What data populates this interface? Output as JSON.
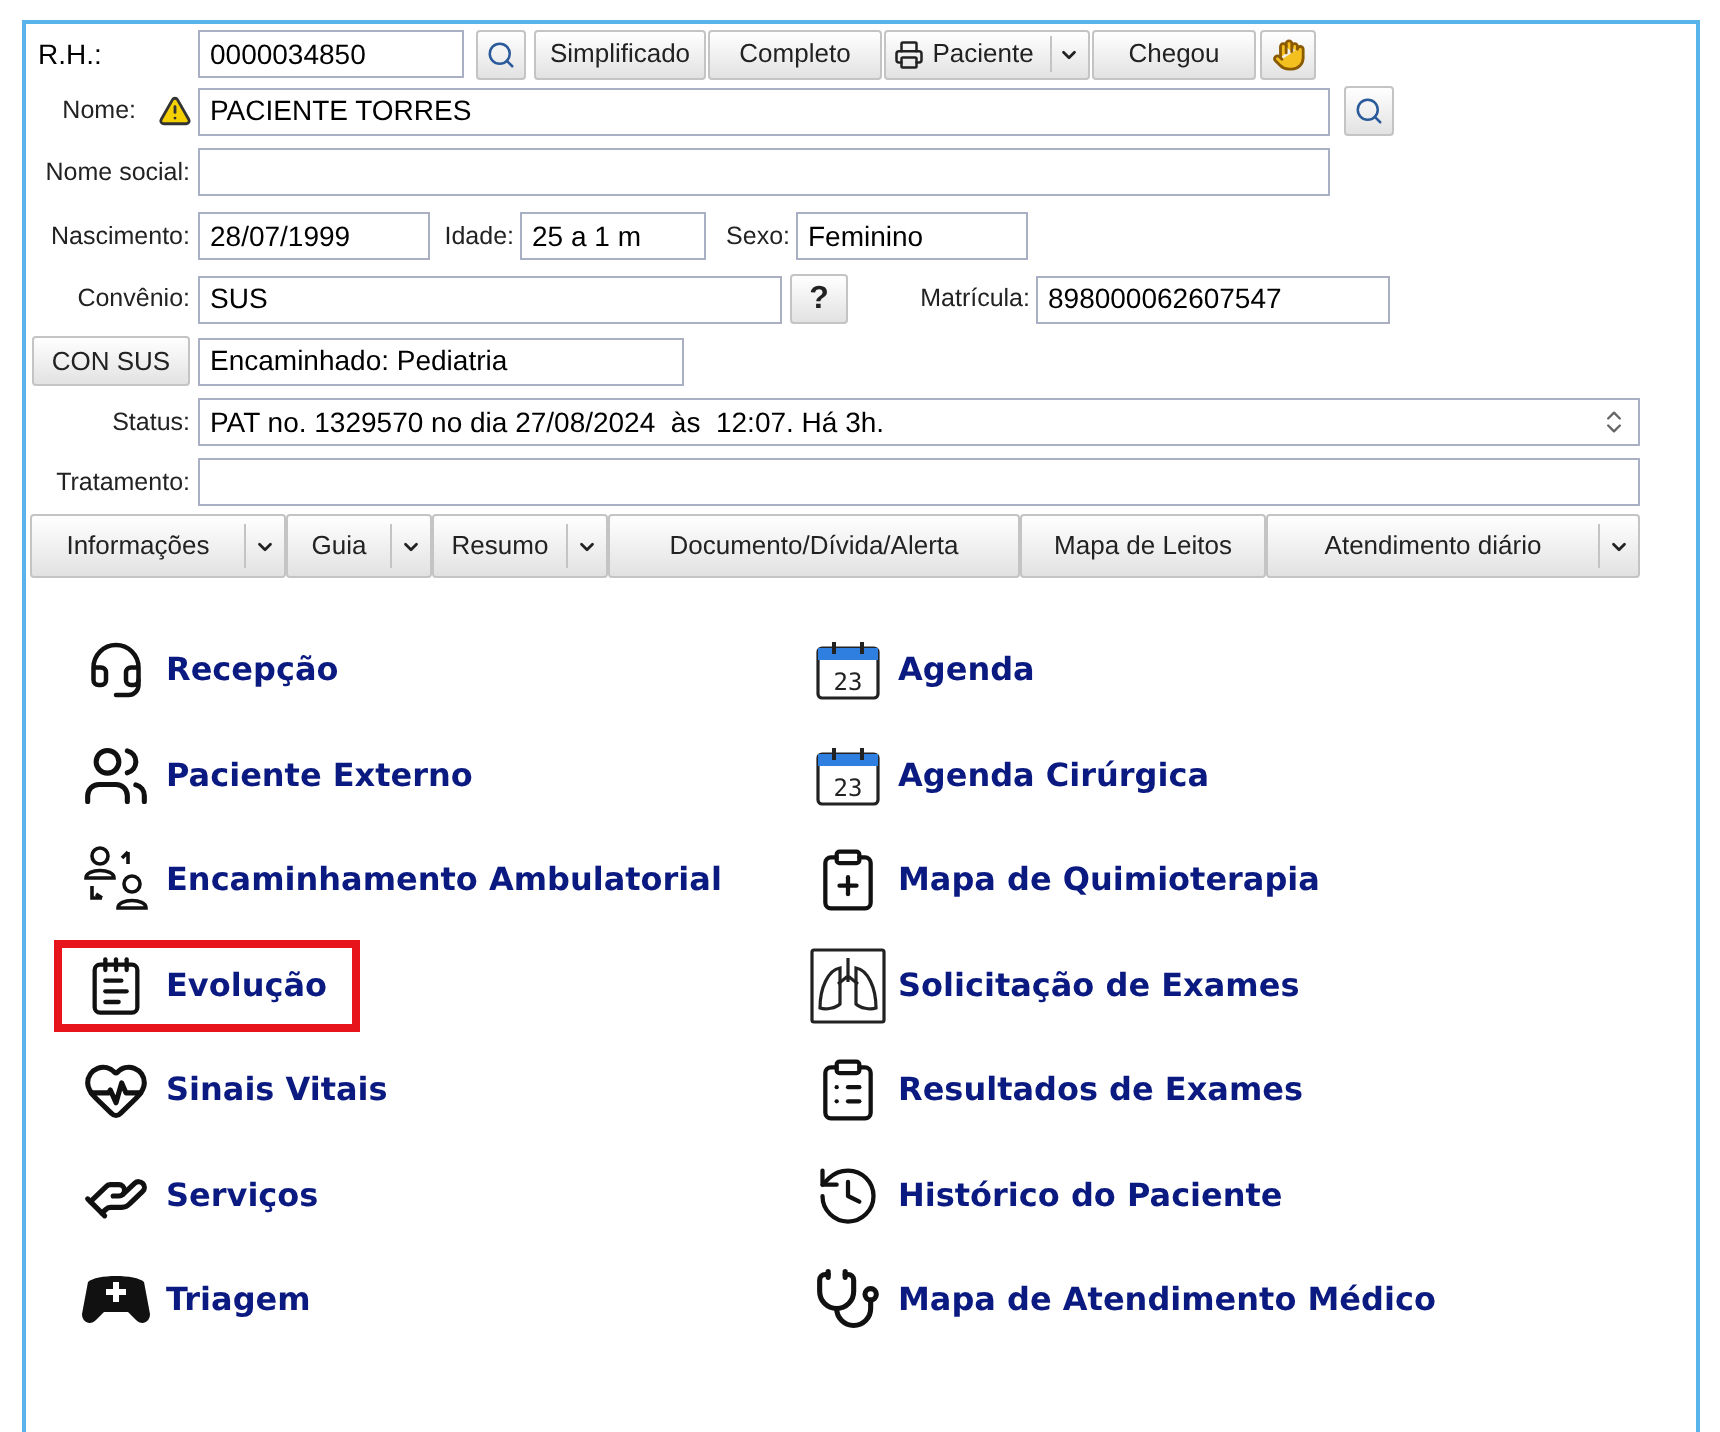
{
  "rh": {
    "label": "R.H.:",
    "value": "0000034850"
  },
  "actions": [
    {
      "label": "Simplificado",
      "kind": "plain"
    },
    {
      "label": "Completo",
      "kind": "plain"
    },
    {
      "label": "Paciente",
      "kind": "print-menu"
    },
    {
      "label": "Chegou",
      "kind": "plain"
    }
  ],
  "nome": {
    "label": "Nome:",
    "value": "PACIENTE TORRES",
    "warning": true
  },
  "nome_social": {
    "label": "Nome social:"
  },
  "nascimento": {
    "label": "Nascimento:",
    "value": "28/07/1999"
  },
  "idade": {
    "label": "Idade:",
    "value": "25 a 1 m"
  },
  "sexo": {
    "label": "Sexo:",
    "value": "Feminino"
  },
  "convenio": {
    "label": "Convênio:",
    "value": "SUS",
    "help_button": "?"
  },
  "matricula": {
    "label": "Matrícula:",
    "value": "898000062607547"
  },
  "con_sus": {
    "button": "CON SUS",
    "value": "Encaminhado: Pediatria"
  },
  "status": {
    "label": "Status:",
    "value": "PAT no. 1329570 no dia 27/08/2024  às  12:07. Há 3h."
  },
  "tratamento": {
    "label": "Tratamento:"
  },
  "tabs": [
    {
      "label": "Informações",
      "dropdown": true
    },
    {
      "label": "Guia",
      "dropdown": true
    },
    {
      "label": "Resumo",
      "dropdown": true
    },
    {
      "label": "Documento/Dívida/Alerta",
      "dropdown": false
    },
    {
      "label": "Mapa de Leitos",
      "dropdown": false
    },
    {
      "label": "Atendimento diário",
      "dropdown": true
    }
  ],
  "menu": {
    "left": [
      {
        "label": "Recepção",
        "highlighted": false
      },
      {
        "label": "Paciente Externo",
        "highlighted": false
      },
      {
        "label": "Encaminhamento Ambulatorial",
        "highlighted": false
      },
      {
        "label": "Evolução",
        "highlighted": true
      },
      {
        "label": "Sinais Vitais",
        "highlighted": false
      },
      {
        "label": "Serviços",
        "highlighted": false
      },
      {
        "label": "Triagem",
        "highlighted": false
      }
    ],
    "right": [
      {
        "label": "Agenda",
        "highlighted": false,
        "icon_text": "23"
      },
      {
        "label": "Agenda Cirúrgica",
        "highlighted": false,
        "icon_text": "23"
      },
      {
        "label": "Mapa de Quimioterapia",
        "highlighted": false
      },
      {
        "label": "Solicitação de Exames",
        "highlighted": false
      },
      {
        "label": "Resultados de Exames",
        "highlighted": false
      },
      {
        "label": "Histórico do Paciente",
        "highlighted": false
      },
      {
        "label": "Mapa de Atendimento Médico",
        "highlighted": false
      }
    ]
  }
}
